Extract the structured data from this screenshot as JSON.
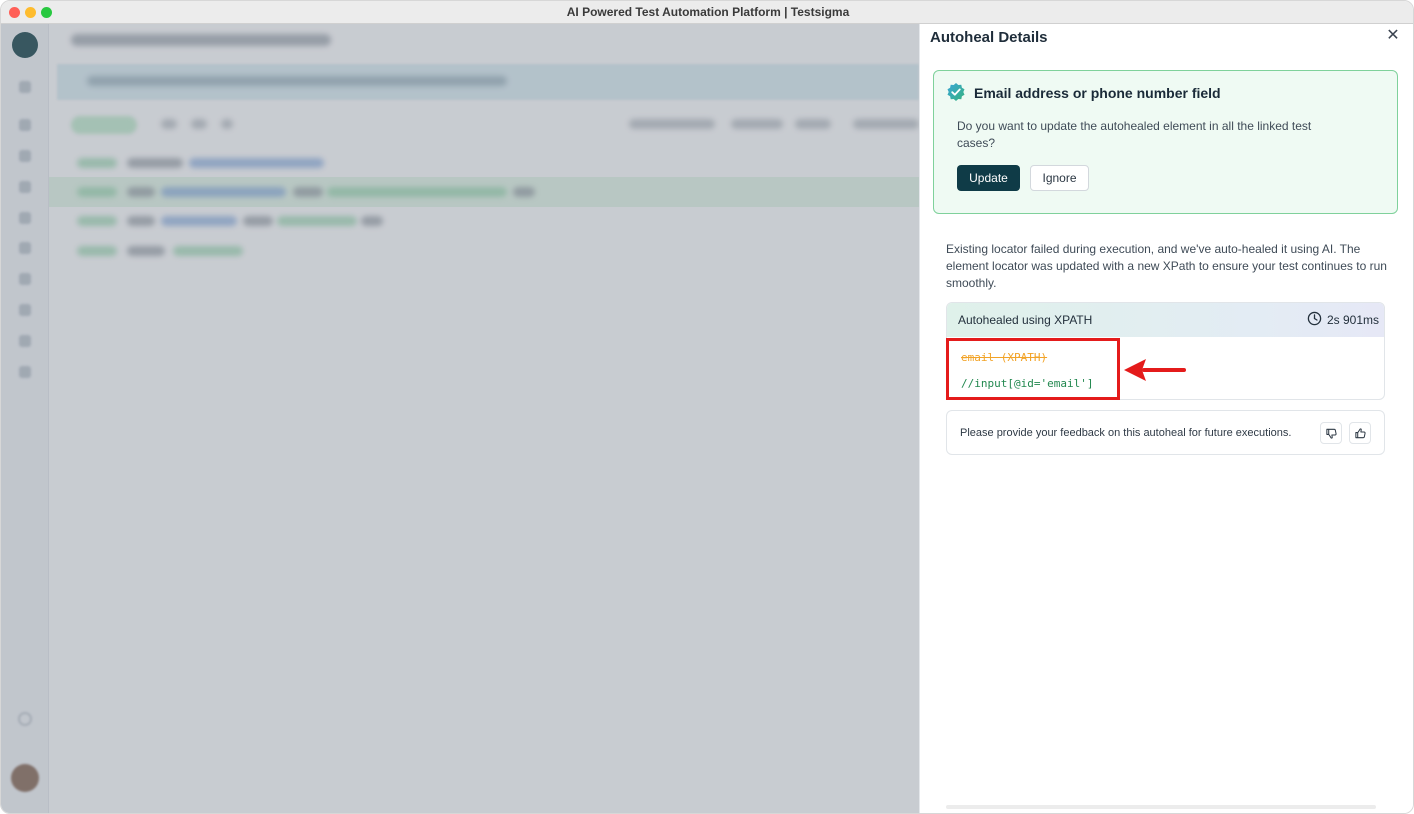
{
  "window": {
    "title": "AI Powered Test Automation Platform | Testsigma"
  },
  "panel": {
    "title": "Autoheal Details",
    "card": {
      "title": "Email address or phone number field",
      "question": "Do you want to update the autohealed element in all the linked test cases?",
      "update_label": "Update",
      "ignore_label": "Ignore"
    },
    "description": "Existing locator failed during execution, and we've auto-healed it using AI. The element locator was updated with a new XPath to ensure your test continues to run smoothly.",
    "xpath": {
      "heading": "Autohealed using XPATH",
      "duration": "2s 901ms",
      "old_locator": "email (XPATH)",
      "new_locator": "//input[@id='email']"
    },
    "feedback": {
      "text": "Please provide your feedback on this autoheal for future executions.",
      "thumbs_down_icon": "thumbs-down-icon",
      "thumbs_up_icon": "thumbs-up-icon"
    }
  },
  "colors": {
    "accent": "#0f3b47",
    "card_border": "#7fd19b",
    "card_bg": "#effaf3",
    "old_locator": "#f2a327",
    "new_locator": "#22884f",
    "annotation": "#e41b1b"
  }
}
